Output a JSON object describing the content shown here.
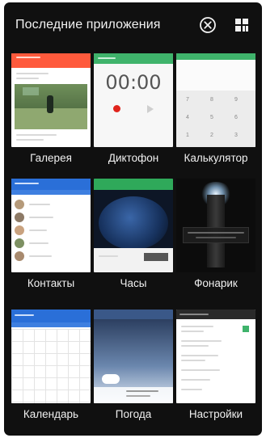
{
  "header": {
    "title": "Последние приложения",
    "close_icon": "close-circle-icon",
    "grid_icon": "grid-layout-icon"
  },
  "apps": [
    {
      "label": "Галерея",
      "accent": "#ff5a3c"
    },
    {
      "label": "Диктофон",
      "accent": "#3fb36b",
      "timer": "00:00"
    },
    {
      "label": "Калькулятор",
      "accent": "#3fb36b",
      "keys": [
        "7",
        "8",
        "9",
        "4",
        "5",
        "6",
        "1",
        "2",
        "3"
      ]
    },
    {
      "label": "Контакты",
      "accent": "#2a6fd8"
    },
    {
      "label": "Часы",
      "accent": "#2fa95a"
    },
    {
      "label": "Фонарик",
      "accent": "#101010"
    },
    {
      "label": "Календарь",
      "accent": "#2a6fd8"
    },
    {
      "label": "Погода",
      "accent": "#5a78a8"
    },
    {
      "label": "Настройки",
      "accent": "#2a2a2a"
    }
  ],
  "colors": {
    "background": "#101010",
    "label_text": "#f0f0f0"
  }
}
